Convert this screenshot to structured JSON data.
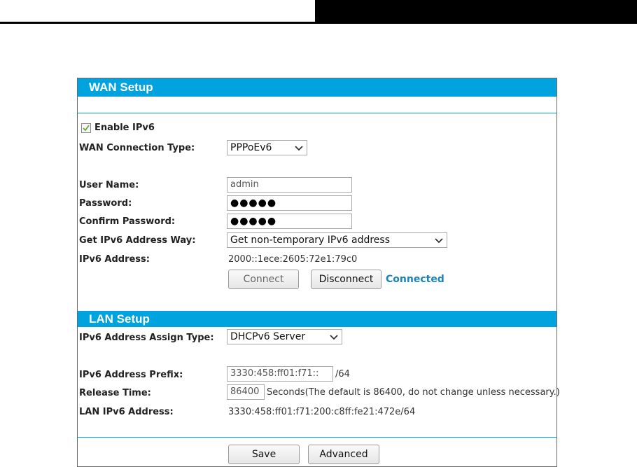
{
  "wan": {
    "title": "WAN Setup",
    "enable_ipv6_label": "Enable IPv6",
    "enable_ipv6_checked": true,
    "conn_type_label": "WAN Connection Type:",
    "conn_type_value": "PPPoEv6",
    "username_label": "User Name:",
    "username_value": "admin",
    "password_label": "Password:",
    "password_mask": "●●●●●",
    "confirm_password_label": "Confirm Password:",
    "confirm_password_mask": "●●●●●",
    "addr_way_label": "Get IPv6 Address Way:",
    "addr_way_value": "Get non-temporary IPv6 address",
    "ipv6_address_label": "IPv6 Address:",
    "ipv6_address_value": "2000::1ece:2605:72e1:79c0",
    "connect_label": "Connect",
    "disconnect_label": "Disconnect",
    "status": "Connected"
  },
  "lan": {
    "title": "LAN Setup",
    "assign_type_label": "IPv6 Address Assign Type:",
    "assign_type_value": "DHCPv6 Server",
    "prefix_label": "IPv6 Address Prefix:",
    "prefix_value": "3330:458:ff01:f71::",
    "prefix_suffix": "/64",
    "release_label": "Release Time:",
    "release_value": "86400",
    "release_note": "Seconds(The default is 86400, do not change unless necessary.)",
    "lan_ipv6_label": "LAN IPv6 Address:",
    "lan_ipv6_value": "3330:458:ff01:f71:200:c8ff:fe21:472e/64"
  },
  "footer": {
    "save_label": "Save",
    "advanced_label": "Advanced"
  },
  "colors": {
    "accent": "#00a3dd",
    "status": "#1a83b8"
  }
}
